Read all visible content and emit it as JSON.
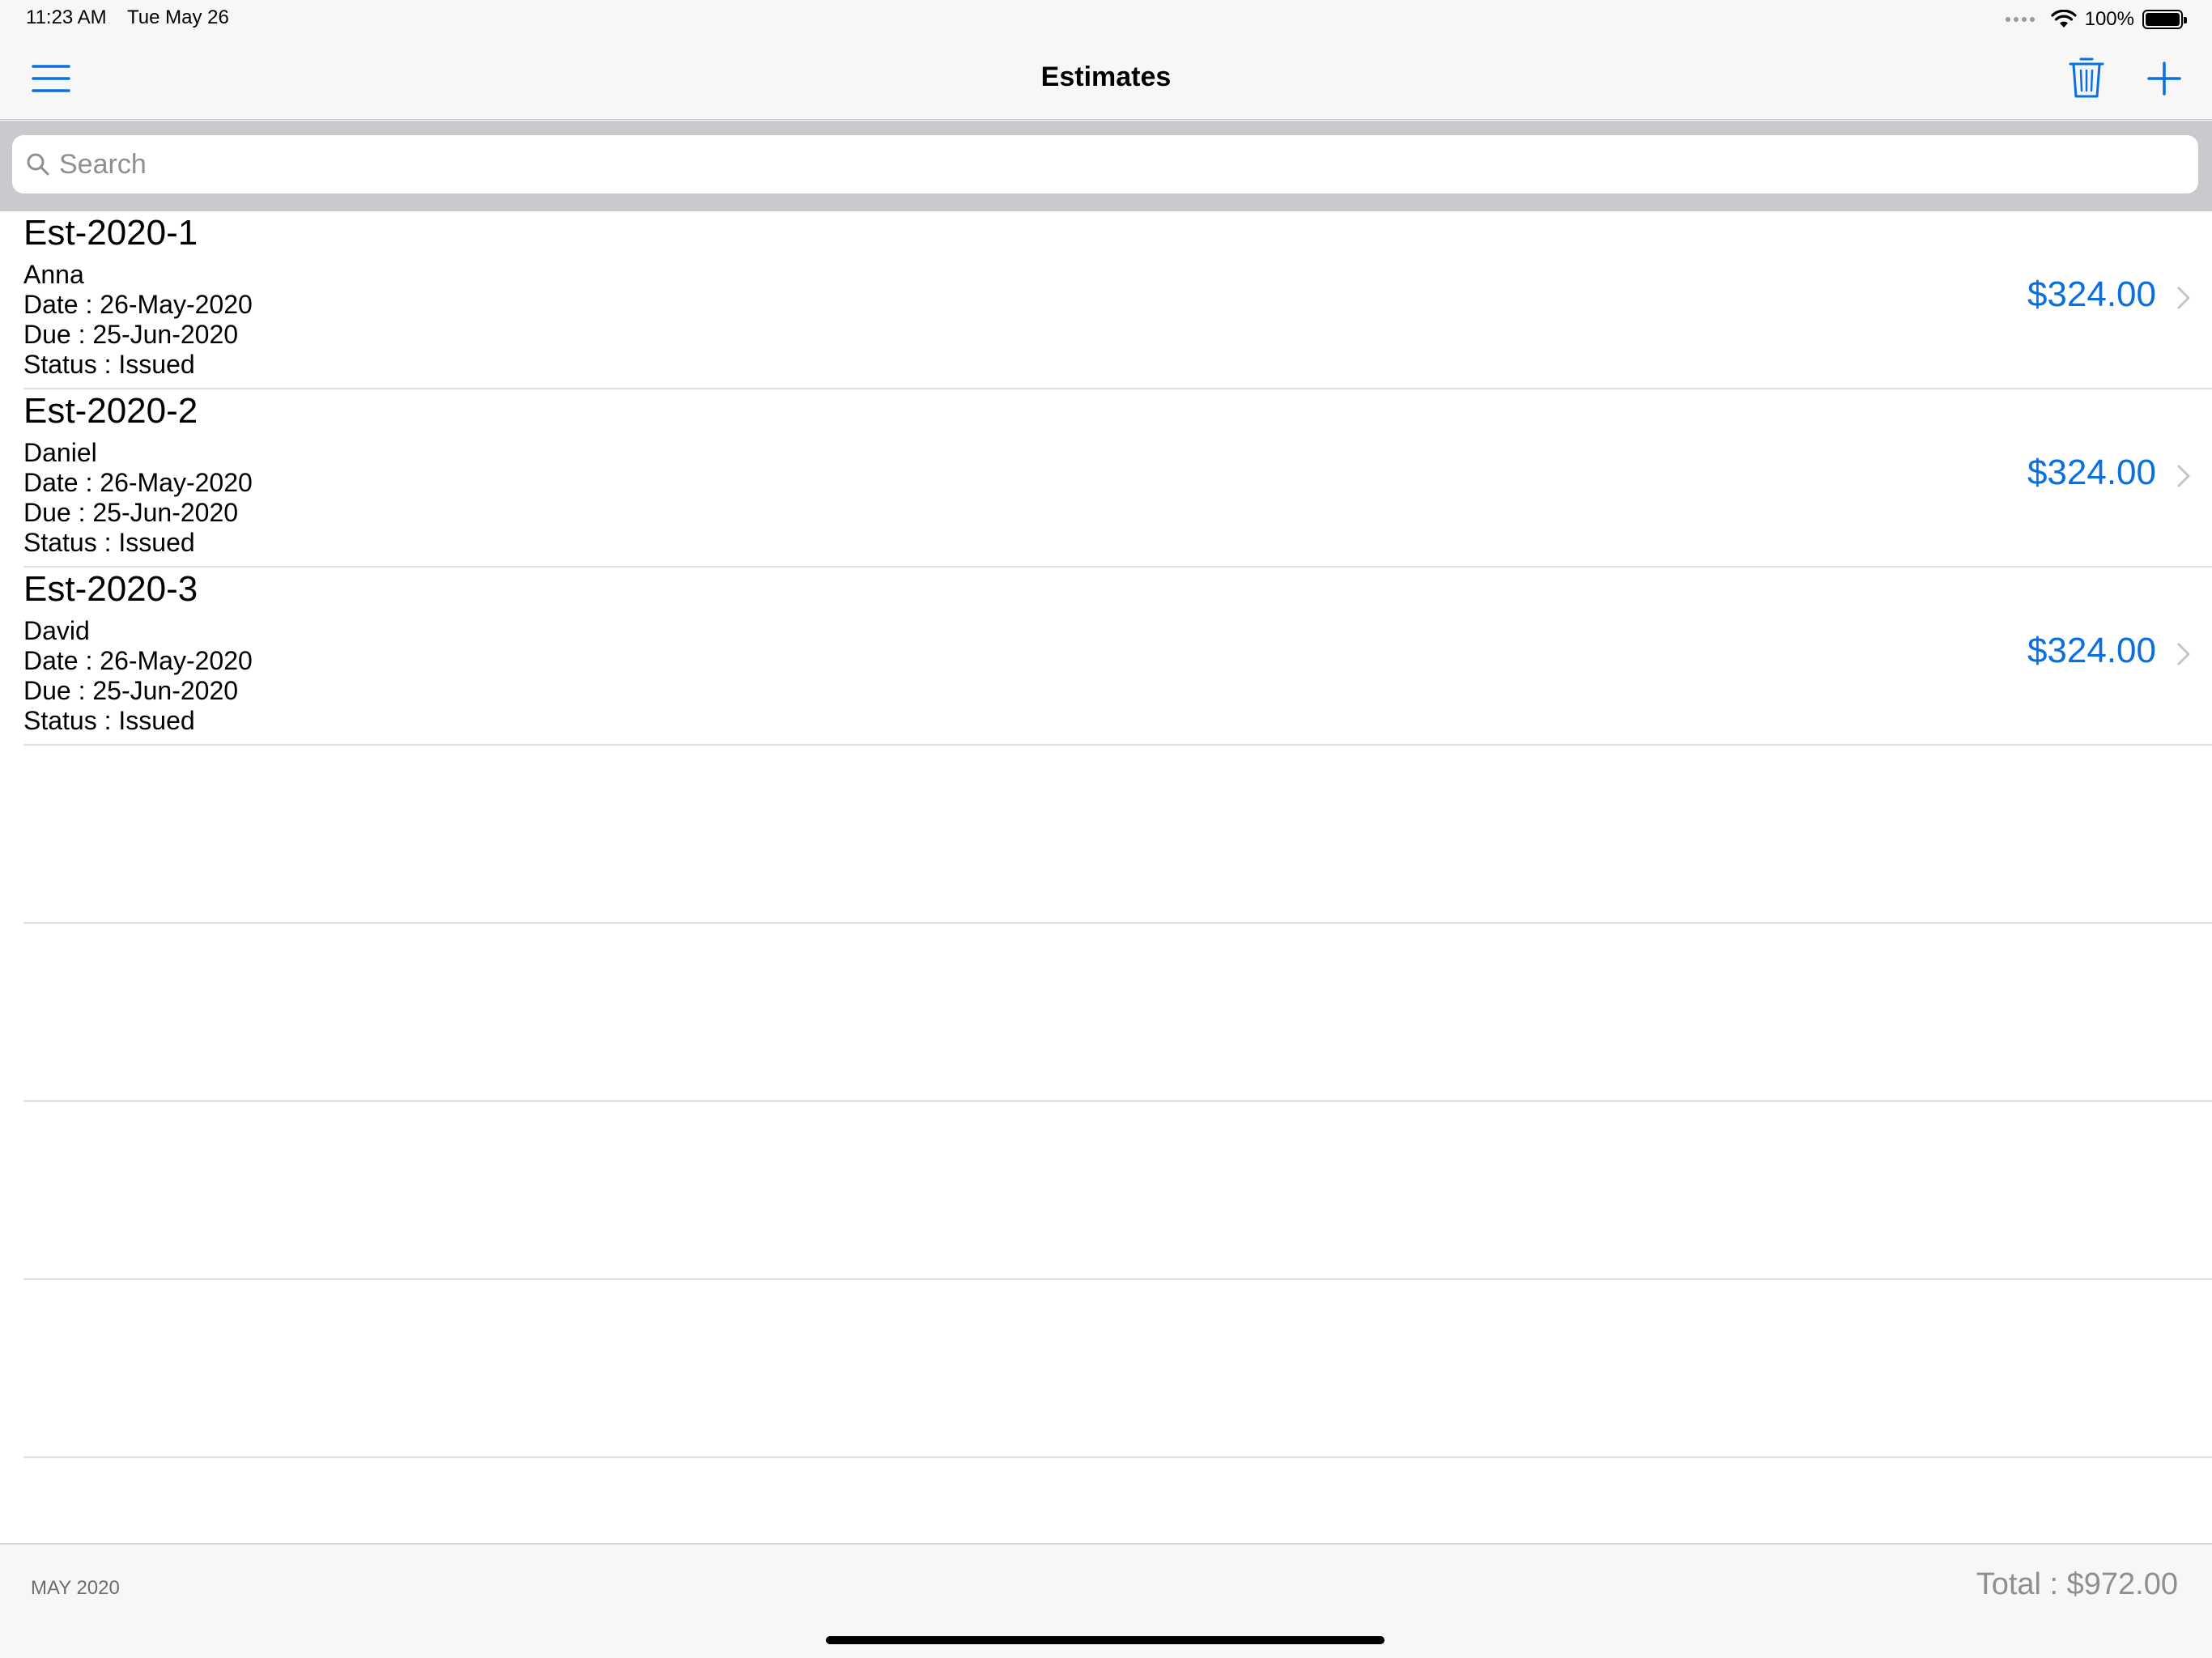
{
  "status_bar": {
    "time": "11:23 AM",
    "date": "Tue May 26",
    "battery": "100%"
  },
  "nav": {
    "title": "Estimates",
    "icons": {
      "menu": "hamburger-menu-icon",
      "delete": "trash-icon",
      "add": "plus-icon"
    }
  },
  "search": {
    "placeholder": "Search",
    "value": ""
  },
  "estimates": [
    {
      "number": "Est-2020-1",
      "customer": "Anna",
      "date": "Date : 26-May-2020",
      "due": "Due : 25-Jun-2020",
      "status": "Status : Issued",
      "amount": "$324.00"
    },
    {
      "number": "Est-2020-2",
      "customer": "Daniel",
      "date": "Date : 26-May-2020",
      "due": "Due : 25-Jun-2020",
      "status": "Status : Issued",
      "amount": "$324.00"
    },
    {
      "number": "Est-2020-3",
      "customer": "David",
      "date": "Date : 26-May-2020",
      "due": "Due : 25-Jun-2020",
      "status": "Status : Issued",
      "amount": "$324.00"
    }
  ],
  "footer": {
    "month": "MAY 2020",
    "total": "Total : $972.00"
  },
  "colors": {
    "accent": "#0a6fe0",
    "bar_background": "#f7f7f7",
    "search_band": "#c9c9ce",
    "separator": "#e0e0e0"
  }
}
